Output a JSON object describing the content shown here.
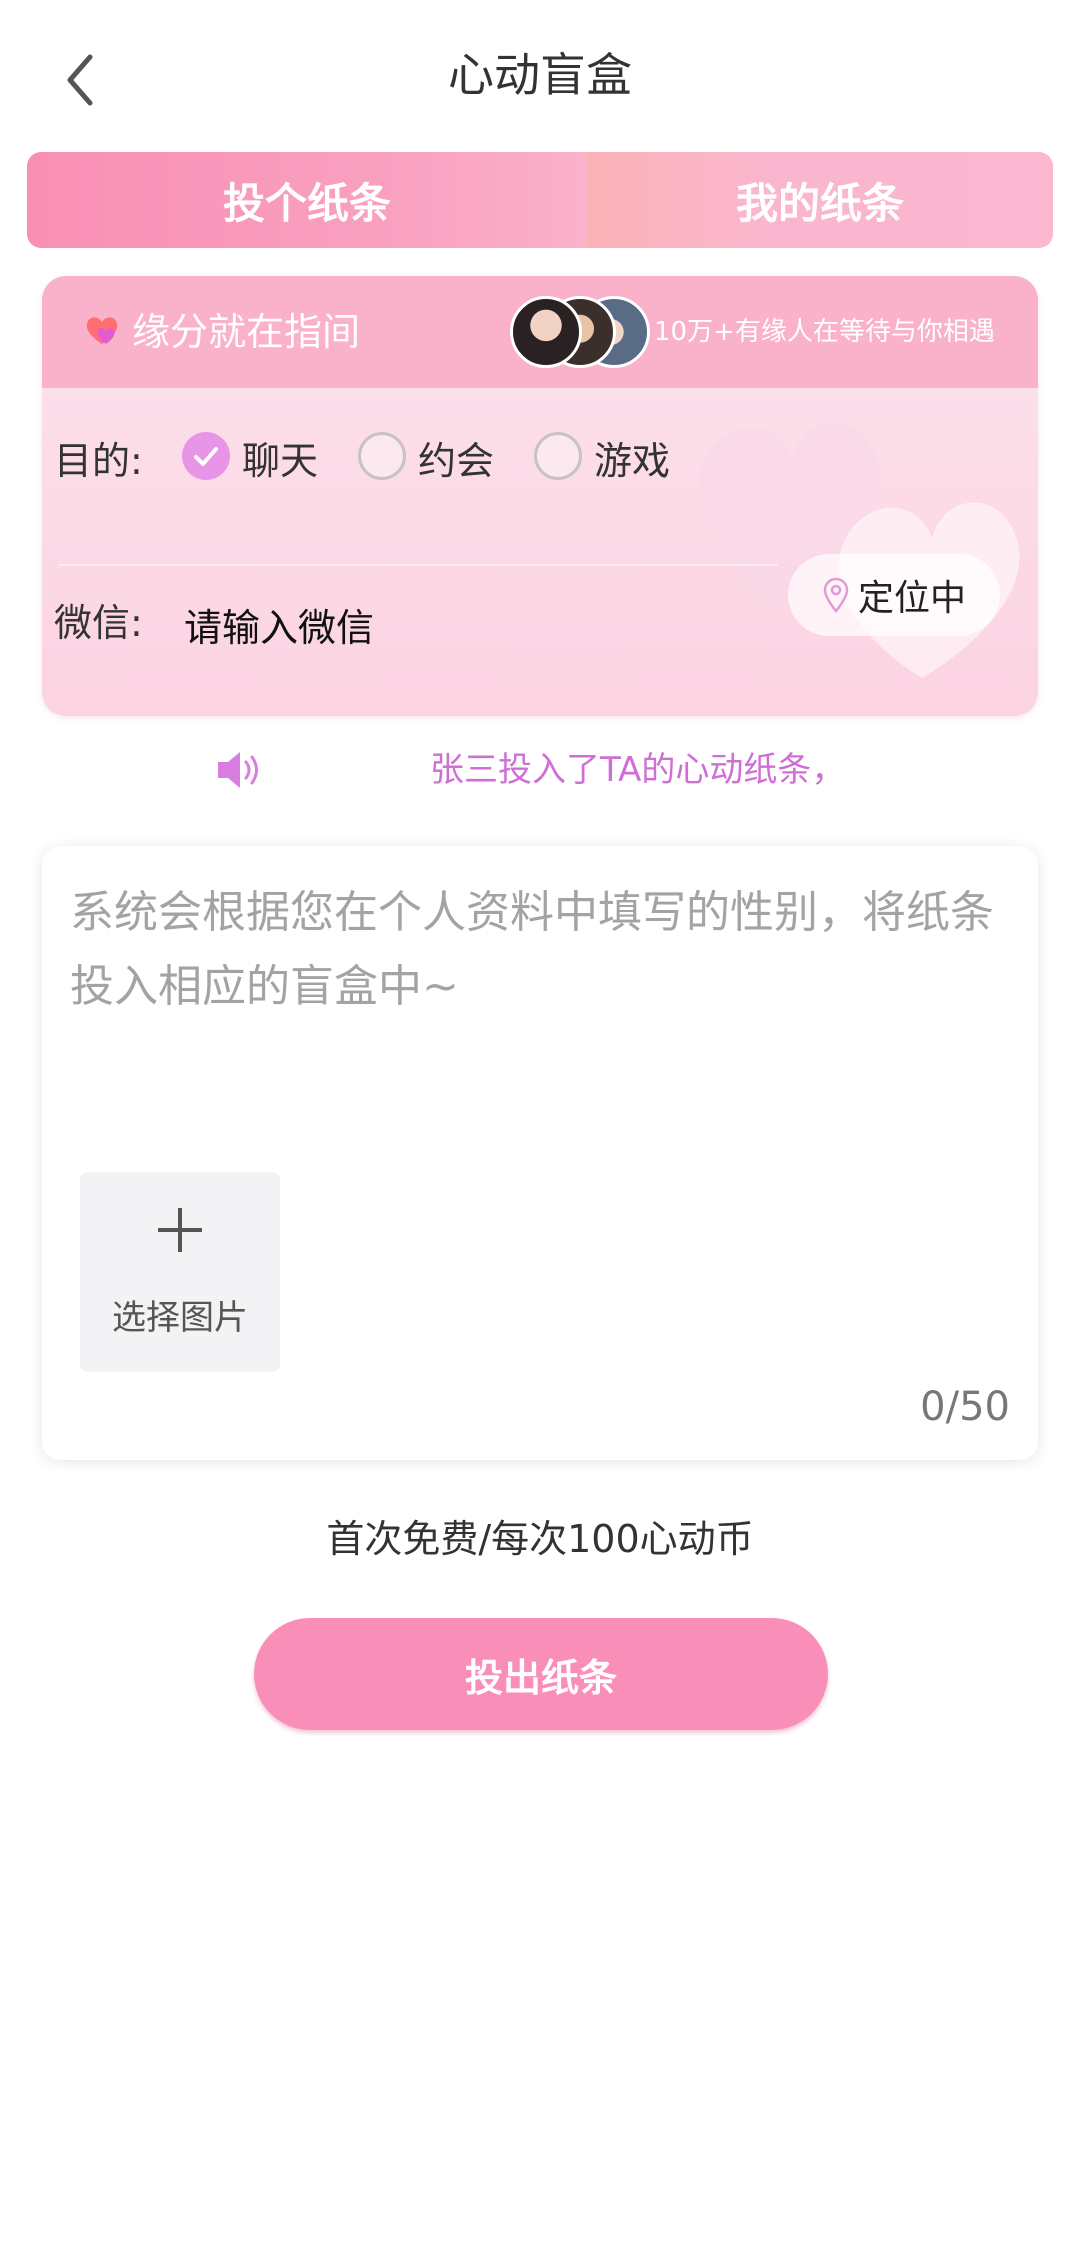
{
  "header": {
    "title": "心动盲盒",
    "back_icon": "chevron-left-icon"
  },
  "tabs": [
    {
      "label": "投个纸条",
      "active": true
    },
    {
      "label": "我的纸条",
      "active": false
    }
  ],
  "match_card": {
    "title": "缘分就在指间",
    "title_icon": "hearts-icon",
    "waiting_text": "10万+有缘人在等待与你相遇",
    "purpose_label": "目的:",
    "options": [
      {
        "label": "聊天",
        "checked": true
      },
      {
        "label": "约会",
        "checked": false
      },
      {
        "label": "游戏",
        "checked": false
      }
    ],
    "wechat_label": "微信:",
    "wechat_placeholder": "请输入微信",
    "location_label": "定位中",
    "location_icon": "location-pin-icon"
  },
  "notice": {
    "icon": "speaker-icon",
    "text": "张三投入了TA的心动纸条，"
  },
  "editor": {
    "placeholder": "系统会根据您在个人资料中填写的性别，将纸条投入相应的盲盒中~",
    "value": "",
    "pick_image_label": "选择图片",
    "pick_image_icon": "plus-icon",
    "counter": "0/50"
  },
  "price_text": "首次免费/每次100心动币",
  "submit_label": "投出纸条",
  "colors": {
    "accent_pink": "#f98fb8",
    "notice_purple": "#cf6fd6",
    "radio_checked": "#e895e8"
  }
}
